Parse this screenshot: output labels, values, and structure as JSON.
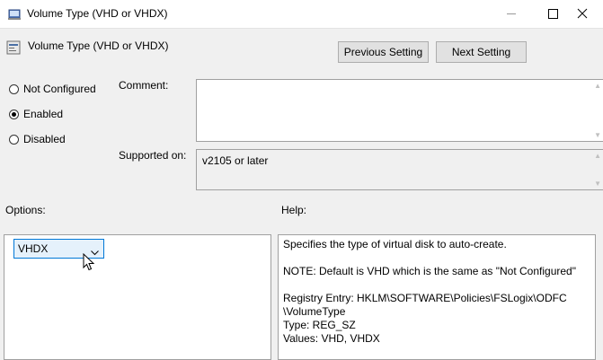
{
  "window": {
    "title": "Volume Type (VHD or VHDX)"
  },
  "header": {
    "title": "Volume Type (VHD or VHDX)",
    "previous_button": "Previous Setting",
    "next_button": "Next Setting"
  },
  "state": {
    "options": [
      {
        "label": "Not Configured",
        "checked": false
      },
      {
        "label": "Enabled",
        "checked": true
      },
      {
        "label": "Disabled",
        "checked": false
      }
    ]
  },
  "comment": {
    "label": "Comment:",
    "value": ""
  },
  "supported": {
    "label": "Supported on:",
    "value": "v2105 or later"
  },
  "options_section": {
    "label": "Options:",
    "dropdown_value": "VHDX"
  },
  "help_section": {
    "label": "Help:",
    "lines": [
      "Specifies the type of virtual disk to auto-create.",
      "",
      "NOTE:  Default is VHD which is the same as \"Not Configured\"",
      "",
      "Registry Entry:  HKLM\\SOFTWARE\\Policies\\FSLogix\\ODFC",
      "\\VolumeType",
      "Type:  REG_SZ",
      "Values:  VHD, VHDX"
    ]
  },
  "icons": {
    "window": "policy-window-icon",
    "header": "policy-setting-icon",
    "dropdown": "chevron-down-icon",
    "cursor": "mouse-pointer-icon"
  },
  "colors": {
    "focus_border": "#0078d7",
    "dropdown_bg": "#e5f1fb",
    "window_bg": "#f0f0f0"
  }
}
